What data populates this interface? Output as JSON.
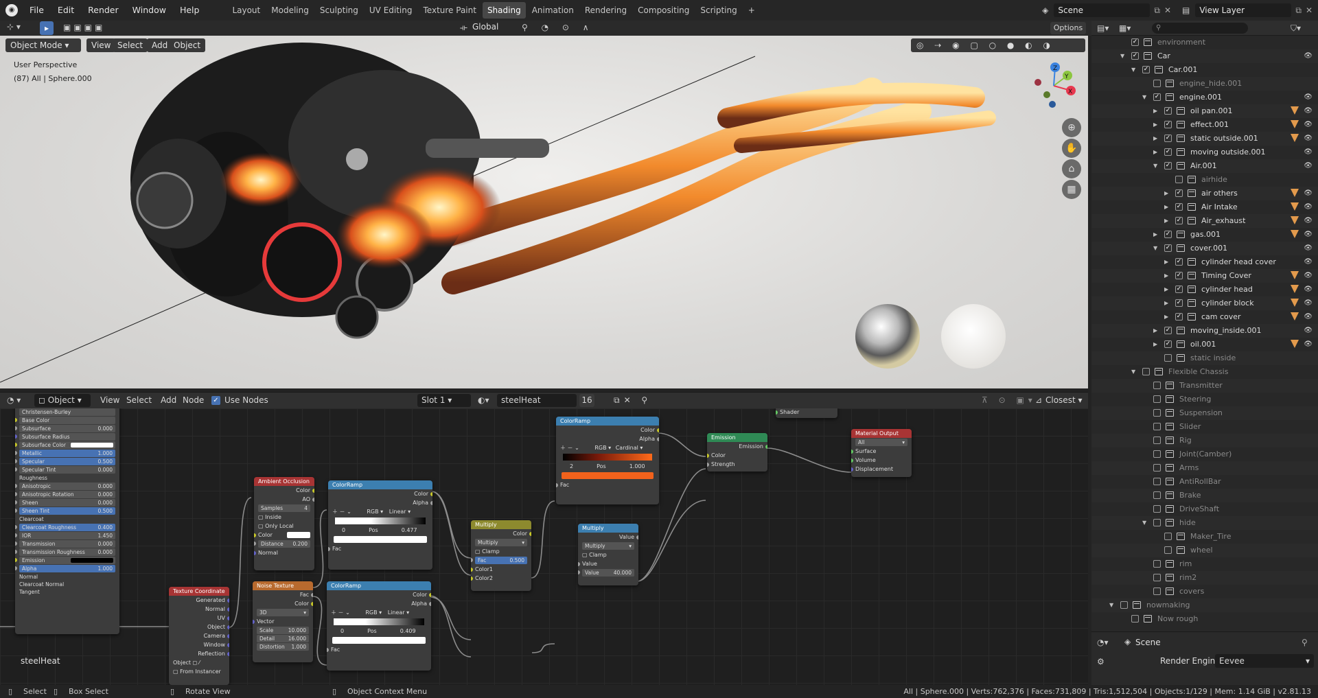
{
  "topbar": {
    "menus": [
      "File",
      "Edit",
      "Render",
      "Window",
      "Help"
    ],
    "workspaces": [
      "Layout",
      "Modeling",
      "Sculpting",
      "UV Editing",
      "Texture Paint",
      "Shading",
      "Animation",
      "Rendering",
      "Compositing",
      "Scripting"
    ],
    "active_workspace": "Shading",
    "add_tab": "+",
    "scene": "Scene",
    "view_layer": "View Layer"
  },
  "viewport_header": {
    "transform_orientation": "Global",
    "options": "Options"
  },
  "viewport": {
    "mode": "Object Mode",
    "menus": [
      "View",
      "Select",
      "Add",
      "Object"
    ],
    "perspective": "User Perspective",
    "info": "(87) All | Sphere.000",
    "gizmo": {
      "x": "X",
      "y": "Y",
      "z": "Z"
    }
  },
  "node_header": {
    "editor_type": "Object",
    "menus": [
      "View",
      "Select",
      "Add",
      "Node"
    ],
    "use_nodes_label": "Use Nodes",
    "slot": "Slot 1",
    "material": "steelHeat",
    "users": "16",
    "interpolation": "Closest"
  },
  "node_editor": {
    "material_name": "steelHeat",
    "bsdf": {
      "top": "Christensen-Burley",
      "rows": [
        {
          "label": "Base Color",
          "value": ""
        },
        {
          "label": "Subsurface",
          "value": "0.000"
        },
        {
          "label": "Subsurface Radius",
          "value": ""
        },
        {
          "label": "Subsurface Color",
          "value": ""
        },
        {
          "label": "Metallic",
          "value": "1.000"
        },
        {
          "label": "Specular",
          "value": "0.500"
        },
        {
          "label": "Specular Tint",
          "value": "0.000"
        },
        {
          "label": "Roughness",
          "value": ""
        },
        {
          "label": "Anisotropic",
          "value": "0.000"
        },
        {
          "label": "Anisotropic Rotation",
          "value": "0.000"
        },
        {
          "label": "Sheen",
          "value": "0.000"
        },
        {
          "label": "Sheen Tint",
          "value": "0.500"
        },
        {
          "label": "Clearcoat",
          "value": ""
        },
        {
          "label": "Clearcoat Roughness",
          "value": "0.400"
        },
        {
          "label": "IOR",
          "value": "1.450"
        },
        {
          "label": "Transmission",
          "value": "0.000"
        },
        {
          "label": "Transmission Roughness",
          "value": "0.000"
        },
        {
          "label": "Emission",
          "value": ""
        },
        {
          "label": "Alpha",
          "value": "1.000"
        },
        {
          "label": "Normal",
          "value": ""
        },
        {
          "label": "Clearcoat Normal",
          "value": ""
        },
        {
          "label": "Tangent",
          "value": ""
        }
      ]
    },
    "ao": {
      "title": "Ambient Occlusion",
      "out_color": "Color",
      "out_ao": "AO",
      "samples_label": "Samples",
      "samples": "4",
      "inside": "Inside",
      "only_local": "Only Local",
      "color": "Color",
      "distance_label": "Distance",
      "distance": "0.200",
      "normal": "Normal"
    },
    "cr1": {
      "title": "ColorRamp",
      "color": "Color",
      "alpha": "Alpha",
      "mode": "RGB",
      "interp": "Linear",
      "index": "0",
      "pos_label": "Pos",
      "pos": "0.477",
      "fac": "Fac"
    },
    "cr2": {
      "title": "ColorRamp",
      "color": "Color",
      "alpha": "Alpha",
      "mode": "RGB",
      "interp": "Linear",
      "index": "0",
      "pos_label": "Pos",
      "pos": "0.409",
      "fac": "Fac"
    },
    "cr3": {
      "title": "ColorRamp",
      "color": "Color",
      "alpha": "Alpha",
      "mode": "RGB",
      "interp": "Cardinal",
      "index": "2",
      "pos_label": "Pos",
      "pos": "1.000",
      "fac": "Fac"
    },
    "noise": {
      "title": "Noise Texture",
      "fac": "Fac",
      "color": "Color",
      "dim": "3D",
      "vector": "Vector",
      "scale_label": "Scale",
      "scale": "10.000",
      "detail_label": "Detail",
      "detail": "16.000",
      "distortion_label": "Distortion",
      "distortion": "1.000"
    },
    "texcoord": {
      "title": "Texture Coordinate",
      "outs": [
        "Generated",
        "Normal",
        "UV",
        "Object",
        "Camera",
        "Window",
        "Reflection"
      ],
      "object_label": "Object",
      "from_instancer": "From Instancer"
    },
    "mult1": {
      "title": "Multiply",
      "color": "Color",
      "op": "Multiply",
      "clamp": "Clamp",
      "fac": "Fac",
      "fac_val": "0.500",
      "c1": "Color1",
      "c2": "Color2"
    },
    "mult2": {
      "title": "Multiply",
      "value": "Value",
      "op": "Multiply",
      "clamp": "Clamp",
      "in_value": "Value",
      "val_label": "Value",
      "val": "40.000"
    },
    "emission": {
      "title": "Emission",
      "out": "Emission",
      "color": "Color",
      "strength": "Strength"
    },
    "shader_label": "Shader",
    "output": {
      "title": "Material Output",
      "target": "All",
      "surface": "Surface",
      "volume": "Volume",
      "displacement": "Displacement"
    }
  },
  "outliner": {
    "rows": [
      {
        "name": "environment",
        "dim": true,
        "d": 1,
        "cb": true,
        "eye": false
      },
      {
        "name": "Car",
        "d": 1,
        "tri": "down",
        "cb": true,
        "eye": true
      },
      {
        "name": "Car.001",
        "d": 2,
        "tri": "down",
        "cb": true,
        "eye": false
      },
      {
        "name": "engine_hide.001",
        "d": 3,
        "dim": true,
        "cb": false,
        "eye": false
      },
      {
        "name": "engine.001",
        "d": 3,
        "tri": "down",
        "cb": true,
        "eye": true
      },
      {
        "name": "oil pan.001",
        "d": 4,
        "tri": "right",
        "cb": true,
        "eye": true,
        "funnel": true
      },
      {
        "name": "effect.001",
        "d": 4,
        "tri": "right",
        "cb": true,
        "eye": true,
        "funnel": true
      },
      {
        "name": "static outside.001",
        "d": 4,
        "tri": "right",
        "cb": true,
        "eye": true,
        "funnel": true
      },
      {
        "name": "moving outside.001",
        "d": 4,
        "tri": "right",
        "cb": true,
        "eye": true
      },
      {
        "name": "Air.001",
        "d": 4,
        "tri": "down",
        "cb": true,
        "eye": true
      },
      {
        "name": "airhide",
        "d": 5,
        "dim": true,
        "cb": false,
        "eye": false
      },
      {
        "name": "air others",
        "d": 5,
        "tri": "right",
        "cb": true,
        "eye": true,
        "funnel": true
      },
      {
        "name": "Air Intake",
        "d": 5,
        "tri": "right",
        "cb": true,
        "eye": true,
        "funnel": true
      },
      {
        "name": "Air_exhaust",
        "d": 5,
        "tri": "right",
        "cb": true,
        "eye": true,
        "funnel": true
      },
      {
        "name": "gas.001",
        "d": 4,
        "tri": "right",
        "cb": true,
        "eye": true,
        "funnel": true
      },
      {
        "name": "cover.001",
        "d": 4,
        "tri": "down",
        "cb": true,
        "eye": true
      },
      {
        "name": "cylinder head cover",
        "d": 5,
        "tri": "right",
        "cb": true,
        "eye": true
      },
      {
        "name": "Timing Cover",
        "d": 5,
        "tri": "right",
        "cb": true,
        "eye": true,
        "funnel": true
      },
      {
        "name": "cylinder head",
        "d": 5,
        "tri": "right",
        "cb": true,
        "eye": true,
        "funnel": true
      },
      {
        "name": "cylinder block",
        "d": 5,
        "tri": "right",
        "cb": true,
        "eye": true,
        "funnel": true
      },
      {
        "name": "cam cover",
        "d": 5,
        "tri": "right",
        "cb": true,
        "eye": true,
        "funnel": true
      },
      {
        "name": "moving_inside.001",
        "d": 4,
        "tri": "right",
        "cb": true,
        "eye": true
      },
      {
        "name": "oil.001",
        "d": 4,
        "tri": "right",
        "cb": true,
        "eye": true,
        "funnel": true
      },
      {
        "name": "static inside",
        "d": 4,
        "dim": true,
        "cb": false,
        "eye": false
      },
      {
        "name": "Flexible Chassis",
        "d": 2,
        "tri": "down",
        "dim": true,
        "cb": false,
        "eye": false
      },
      {
        "name": "Transmitter",
        "d": 3,
        "dim": true,
        "cb": false,
        "eye": false
      },
      {
        "name": "Steering",
        "d": 3,
        "dim": true,
        "cb": false,
        "eye": false
      },
      {
        "name": "Suspension",
        "d": 3,
        "dim": true,
        "cb": false,
        "eye": false
      },
      {
        "name": "Slider",
        "d": 3,
        "dim": true,
        "cb": false,
        "eye": false
      },
      {
        "name": "Rig",
        "d": 3,
        "dim": true,
        "cb": false,
        "eye": false
      },
      {
        "name": "Joint(Camber)",
        "d": 3,
        "dim": true,
        "cb": false,
        "eye": false
      },
      {
        "name": "Arms",
        "d": 3,
        "dim": true,
        "cb": false,
        "eye": false
      },
      {
        "name": "AntiRollBar",
        "d": 3,
        "dim": true,
        "cb": false,
        "eye": false
      },
      {
        "name": "Brake",
        "d": 3,
        "dim": true,
        "cb": false,
        "eye": false
      },
      {
        "name": "DriveShaft",
        "d": 3,
        "dim": true,
        "cb": false,
        "eye": false
      },
      {
        "name": "hide",
        "d": 3,
        "tri": "down",
        "dim": true,
        "cb": false,
        "eye": false
      },
      {
        "name": "Maker_Tire",
        "d": 4,
        "dim": true,
        "cb": false,
        "eye": false
      },
      {
        "name": "wheel",
        "d": 4,
        "dim": true,
        "cb": false,
        "eye": false
      },
      {
        "name": "rim",
        "d": 3,
        "dim": true,
        "cb": false,
        "eye": false
      },
      {
        "name": "rim2",
        "d": 3,
        "dim": true,
        "cb": false,
        "eye": false
      },
      {
        "name": "covers",
        "d": 3,
        "dim": true,
        "cb": false,
        "eye": false
      },
      {
        "name": "nowmaking",
        "d": 0,
        "tri": "down",
        "dim": true,
        "cb": false,
        "eye": false
      },
      {
        "name": "Now rough",
        "d": 1,
        "dim": true,
        "cb": false,
        "eye": false
      }
    ]
  },
  "properties": {
    "context": "Scene",
    "render_engine_label": "Render Engine",
    "render_engine": "Eevee"
  },
  "statusbar": {
    "select": "Select",
    "box_select": "Box Select",
    "rotate": "Rotate View",
    "context_menu": "Object Context Menu",
    "stats": "All | Sphere.000 | Verts:762,376 | Faces:731,809 | Tris:1,512,504 | Objects:1/129 | Mem: 1.14 GiB | v2.81.13"
  }
}
